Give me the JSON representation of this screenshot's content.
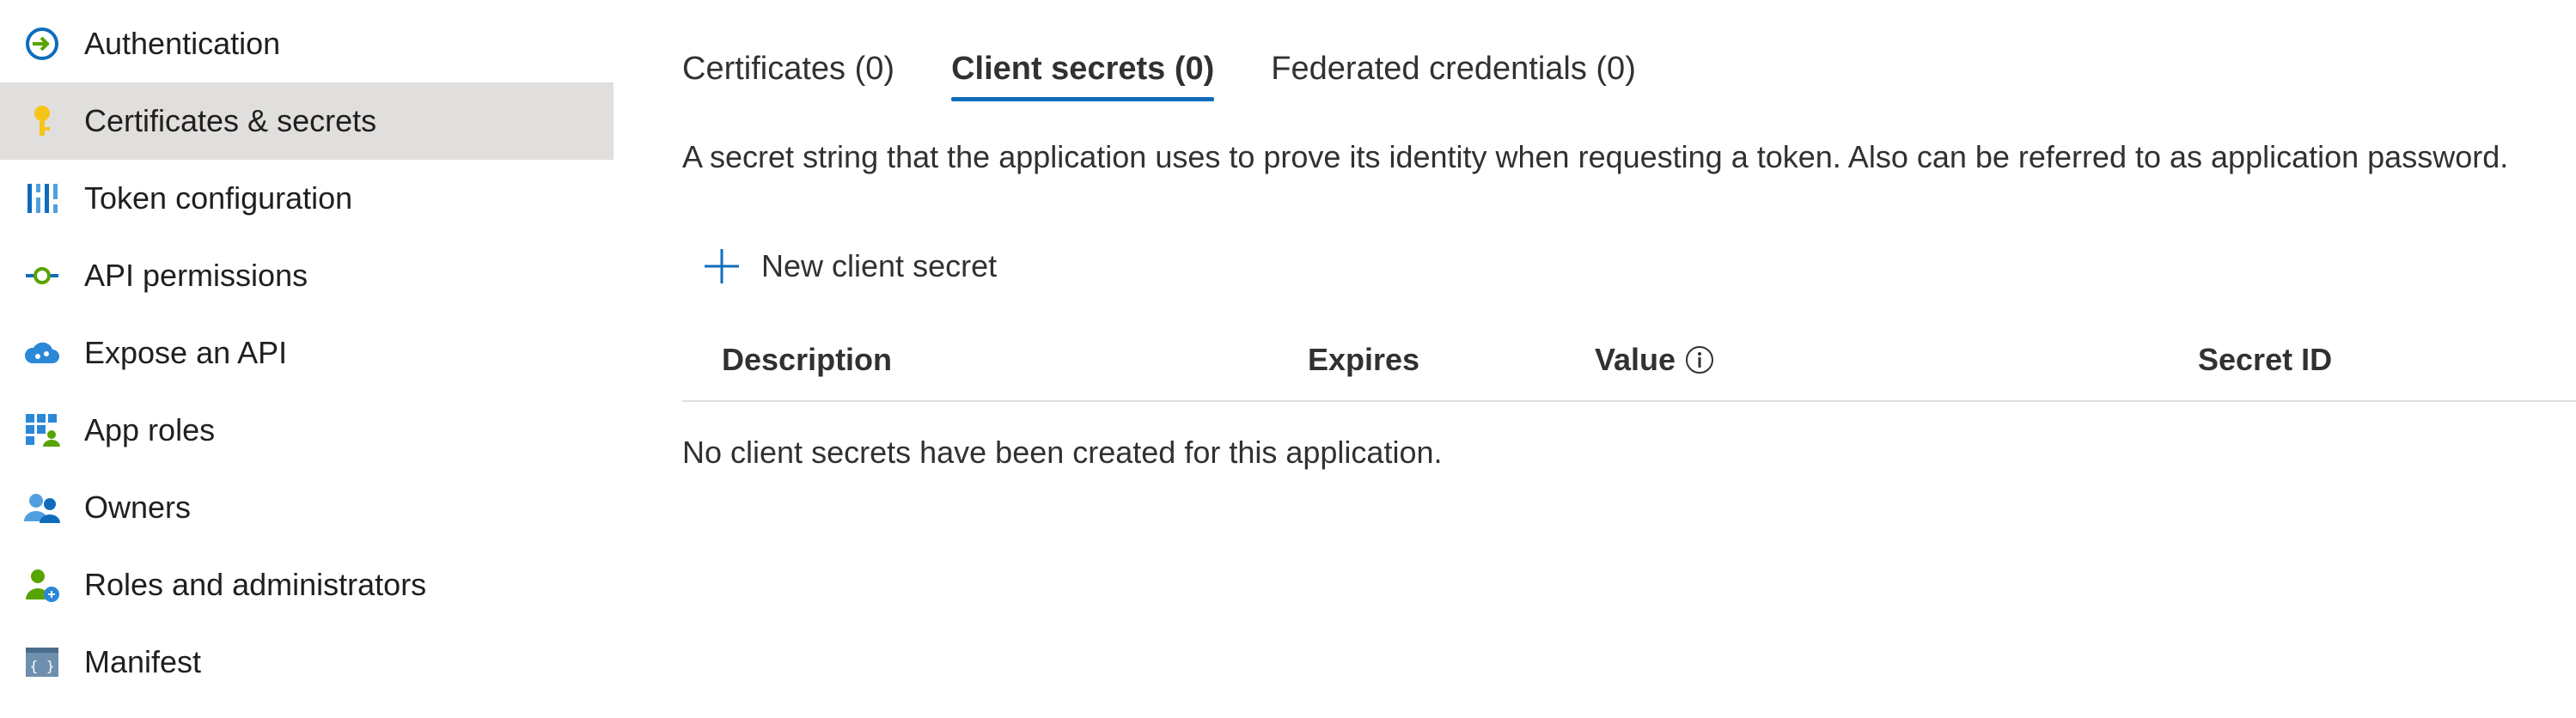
{
  "sidebar": {
    "items": [
      {
        "label": "Authentication",
        "icon": "authentication-icon",
        "selected": false
      },
      {
        "label": "Certificates & secrets",
        "icon": "key-icon",
        "selected": true
      },
      {
        "label": "Token configuration",
        "icon": "token-config-icon",
        "selected": false
      },
      {
        "label": "API permissions",
        "icon": "api-permissions-icon",
        "selected": false
      },
      {
        "label": "Expose an API",
        "icon": "cloud-api-icon",
        "selected": false
      },
      {
        "label": "App roles",
        "icon": "app-roles-icon",
        "selected": false
      },
      {
        "label": "Owners",
        "icon": "owners-icon",
        "selected": false
      },
      {
        "label": "Roles and administrators",
        "icon": "roles-admin-icon",
        "selected": false
      },
      {
        "label": "Manifest",
        "icon": "manifest-icon",
        "selected": false
      }
    ]
  },
  "tabs": [
    {
      "label": "Certificates (0)",
      "active": false
    },
    {
      "label": "Client secrets (0)",
      "active": true
    },
    {
      "label": "Federated credentials (0)",
      "active": false
    }
  ],
  "description": "A secret string that the application uses to prove its identity when requesting a token. Also can be referred to as application password.",
  "toolbar": {
    "new_secret_label": "New client secret"
  },
  "table": {
    "columns": [
      "Description",
      "Expires",
      "Value",
      "Secret ID"
    ],
    "empty_message": "No client secrets have been created for this application."
  },
  "colors": {
    "accent": "#0f6cbd",
    "selected_bg": "#e1dfdd",
    "key_icon": "#f5c518"
  }
}
